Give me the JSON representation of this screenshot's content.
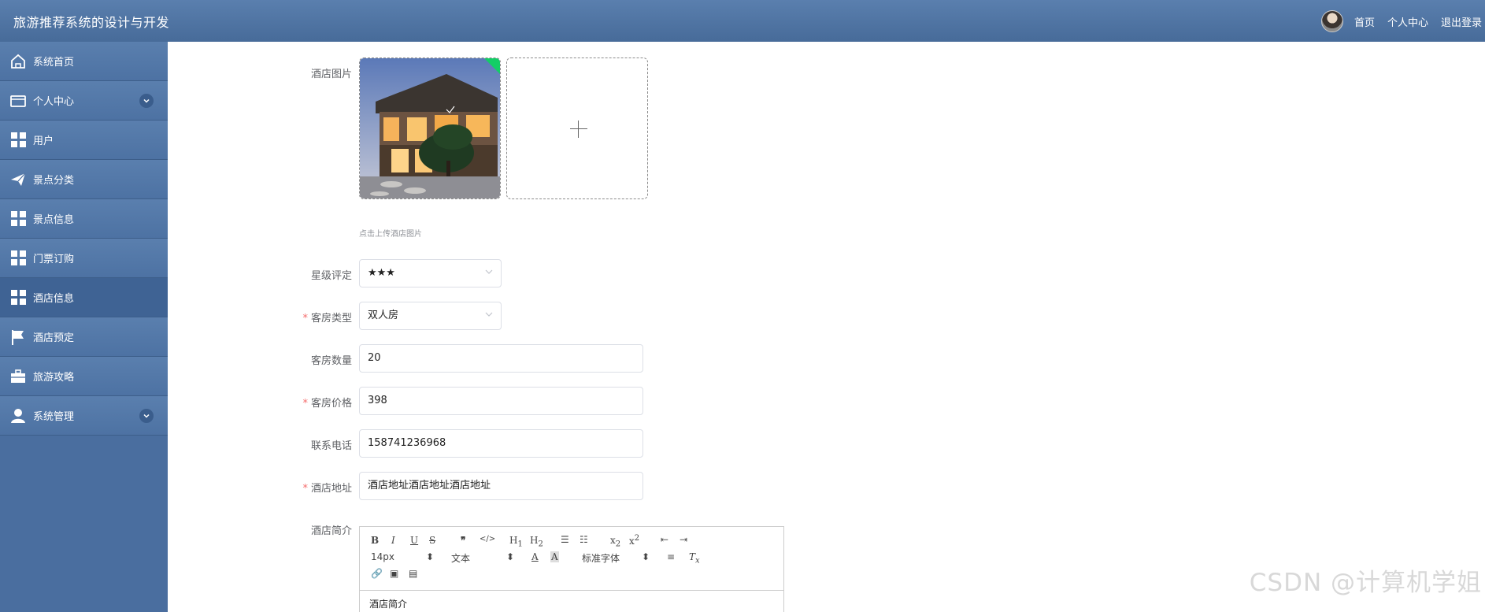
{
  "header": {
    "title": "旅游推荐系统的设计与开发",
    "links": [
      "首页",
      "个人中心",
      "退出登录"
    ]
  },
  "sidebar": {
    "items": [
      {
        "label": "系统首页",
        "icon": "home-icon"
      },
      {
        "label": "个人中心",
        "icon": "wallet-icon",
        "expandable": true
      },
      {
        "label": "用户",
        "icon": "grid-icon"
      },
      {
        "label": "景点分类",
        "icon": "paper-plane-icon"
      },
      {
        "label": "景点信息",
        "icon": "grid-icon"
      },
      {
        "label": "门票订购",
        "icon": "grid-icon"
      },
      {
        "label": "酒店信息",
        "icon": "grid-icon",
        "active": true
      },
      {
        "label": "酒店预定",
        "icon": "flag-icon"
      },
      {
        "label": "旅游攻略",
        "icon": "briefcase-icon"
      },
      {
        "label": "系统管理",
        "icon": "user-icon",
        "expandable": true
      }
    ]
  },
  "form": {
    "hotel_image_label": "酒店图片",
    "upload_hint": "点击上传酒店图片",
    "star_label": "星级评定",
    "star_value": "★★★",
    "room_type_label": "客房类型",
    "room_type_value": "双人房",
    "room_count_label": "客房数量",
    "room_count_value": "20",
    "room_price_label": "客房价格",
    "room_price_value": "398",
    "phone_label": "联系电话",
    "phone_value": "158741236968",
    "address_label": "酒店地址",
    "address_value": "酒店地址酒店地址酒店地址",
    "intro_label": "酒店简介",
    "intro_value": "酒店简介"
  },
  "editor": {
    "font_size": "14px",
    "format": "文本",
    "font_family": "标准字体"
  },
  "watermark": "CSDN @计算机学姐",
  "colors": {
    "header": "#5a7fae",
    "sidebar": "#4a6e9f",
    "required": "#f56c6c"
  }
}
